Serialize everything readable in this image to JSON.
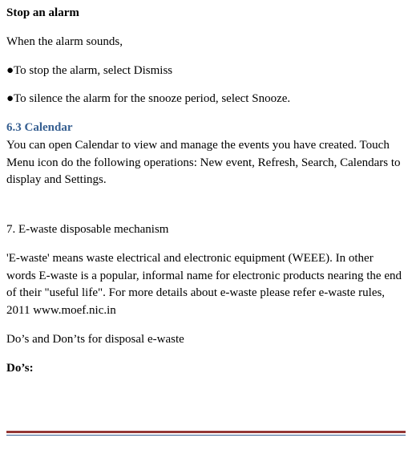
{
  "heading_stop_alarm": "Stop an alarm",
  "intro_when_sounds": "When the alarm sounds,",
  "bullet_dismiss": "●To stop the alarm, select Dismiss",
  "bullet_snooze": "●To silence the alarm for the snooze period, select Snooze.",
  "section_calendar_title": "6.3 Calendar",
  "section_calendar_body": "You can open Calendar to view and manage the events you have created. Touch Menu icon do the following operations: New event, Refresh, Search, Calendars to display and Settings.",
  "section_ewaste_title": "7. E-waste disposable mechanism",
  "section_ewaste_body": "'E-waste' means waste electrical and electronic equipment (WEEE). In other words E-waste is a popular, informal name for electronic products nearing the end of their \"useful life\". For more details about e-waste please refer e-waste rules, 2011 www.moef.nic.in",
  "dos_donts_line": "Do’s and Don’ts for disposal e-waste",
  "dos_label": "Do’s:"
}
